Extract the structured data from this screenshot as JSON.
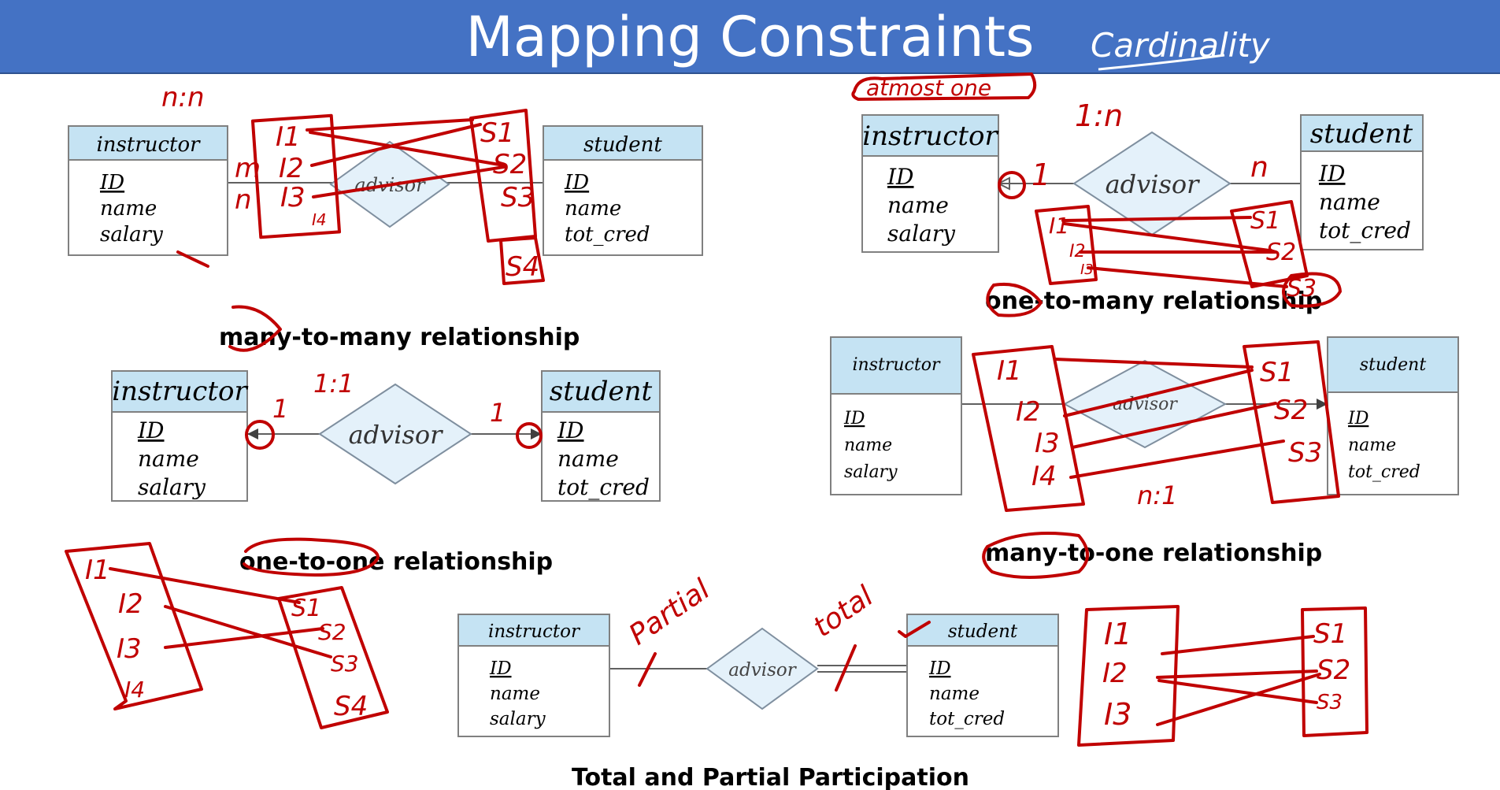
{
  "title": "Mapping Constraints",
  "handwritten": {
    "cardinality": "Cardinality",
    "nn": "n:n",
    "one_n": "1:n",
    "n_one": "n:1",
    "atmost_one": "atmost one",
    "partial": "Partial",
    "total": "total",
    "m": "m",
    "n": "n",
    "one": "1",
    "one_eight": "1:1"
  },
  "diagrams": {
    "many_to_many": {
      "caption": "many-to-many relationship",
      "left_entity": {
        "name": "instructor",
        "attrs": [
          "ID",
          "name",
          "salary"
        ]
      },
      "relationship": "advisor",
      "right_entity": {
        "name": "student",
        "attrs": [
          "ID",
          "name",
          "tot_cred"
        ]
      },
      "left_set": [
        "I1",
        "I2",
        "I3",
        "I4"
      ],
      "right_set": [
        "S1",
        "S2",
        "S3",
        "S4"
      ]
    },
    "one_to_many": {
      "caption": "one-to-many relationship",
      "left_entity": {
        "name": "instructor",
        "attrs": [
          "ID",
          "name",
          "salary"
        ]
      },
      "relationship": "advisor",
      "right_entity": {
        "name": "student",
        "attrs": [
          "ID",
          "name",
          "tot_cred"
        ]
      },
      "left_set": [
        "I1",
        "I2",
        "I3"
      ],
      "right_set": [
        "S1",
        "S2",
        "S3"
      ]
    },
    "one_to_one": {
      "caption": "one-to-one relationship",
      "left_entity": {
        "name": "instructor",
        "attrs": [
          "ID",
          "name",
          "salary"
        ]
      },
      "relationship": "advisor",
      "right_entity": {
        "name": "student",
        "attrs": [
          "ID",
          "name",
          "tot_cred"
        ]
      },
      "left_set": [
        "I1",
        "I2",
        "I3",
        "I4"
      ],
      "right_set": [
        "S1",
        "S2",
        "S3",
        "S4"
      ]
    },
    "many_to_one": {
      "caption": "many-to-one relationship",
      "left_entity": {
        "name": "instructor",
        "attrs": [
          "ID",
          "name",
          "salary"
        ]
      },
      "relationship": "advisor",
      "right_entity": {
        "name": "student",
        "attrs": [
          "ID",
          "name",
          "tot_cred"
        ]
      },
      "left_set": [
        "I1",
        "I2",
        "I3",
        "I4"
      ],
      "right_set": [
        "S1",
        "S2",
        "S3"
      ]
    },
    "participation": {
      "caption": "Total and Partial Participation",
      "left_entity": {
        "name": "instructor",
        "attrs": [
          "ID",
          "name",
          "salary"
        ]
      },
      "relationship": "advisor",
      "right_entity": {
        "name": "student",
        "attrs": [
          "ID",
          "name",
          "tot_cred"
        ]
      },
      "left_set": [
        "I1",
        "I2",
        "I3"
      ],
      "right_set": [
        "S1",
        "S2",
        "S3"
      ]
    }
  }
}
